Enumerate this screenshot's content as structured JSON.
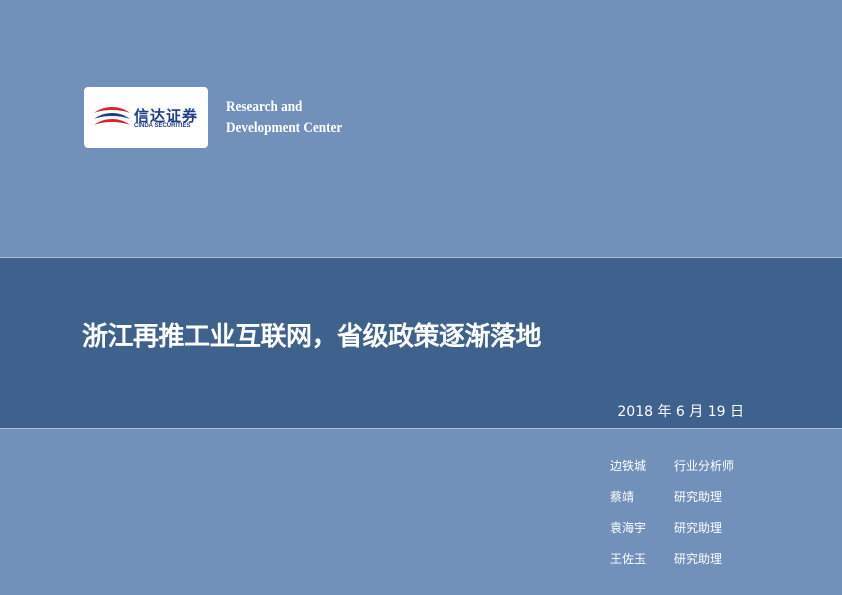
{
  "logo": {
    "cn_text": "信达证券",
    "en_text": "CINDA SECURITIES",
    "colors": {
      "red": "#d6262c",
      "navy": "#1d3f8a"
    }
  },
  "tagline": {
    "line1": "Research and",
    "line2": "Development Center"
  },
  "report": {
    "title": "浙江再推工业互联网，省级政策逐渐落地",
    "date": "2018 年 6 月 19 日"
  },
  "authors": [
    {
      "name": "边铁城",
      "role": "行业分析师"
    },
    {
      "name": "蔡靖",
      "role": "研究助理"
    },
    {
      "name": "袁海宇",
      "role": "研究助理"
    },
    {
      "name": "王佐玉",
      "role": "研究助理"
    }
  ],
  "theme": {
    "background": "#7191bb",
    "band": "#3e618e"
  }
}
